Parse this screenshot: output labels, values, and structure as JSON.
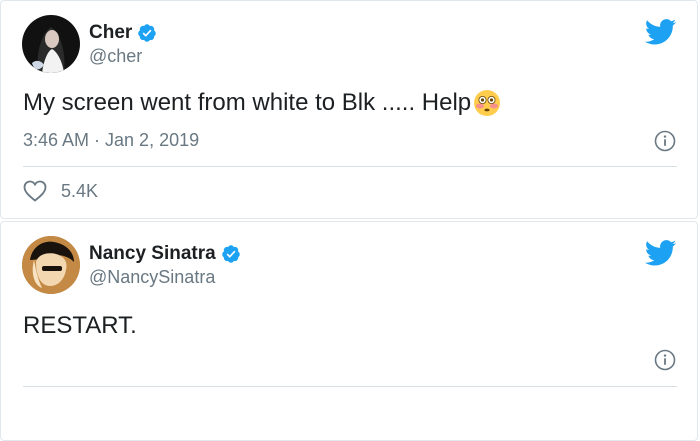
{
  "tweets": [
    {
      "name": "Cher",
      "handle": "@cher",
      "text": "My screen went from white to Blk ..... Help",
      "emoji": "flushed-face-emoji",
      "timestamp": "3:46 AM · Jan 2, 2019",
      "likes": "5.4K",
      "verified": true
    },
    {
      "name": "Nancy Sinatra",
      "handle": "@NancySinatra",
      "text": "RESTART.",
      "verified": true
    }
  ],
  "colors": {
    "twitter_blue": "#1da1f2",
    "secondary_text": "#697882",
    "primary_text": "#1c2022",
    "border": "#e1e8ed"
  },
  "icons": [
    "twitter-bird-icon",
    "verified-badge-icon",
    "info-icon",
    "heart-icon"
  ]
}
